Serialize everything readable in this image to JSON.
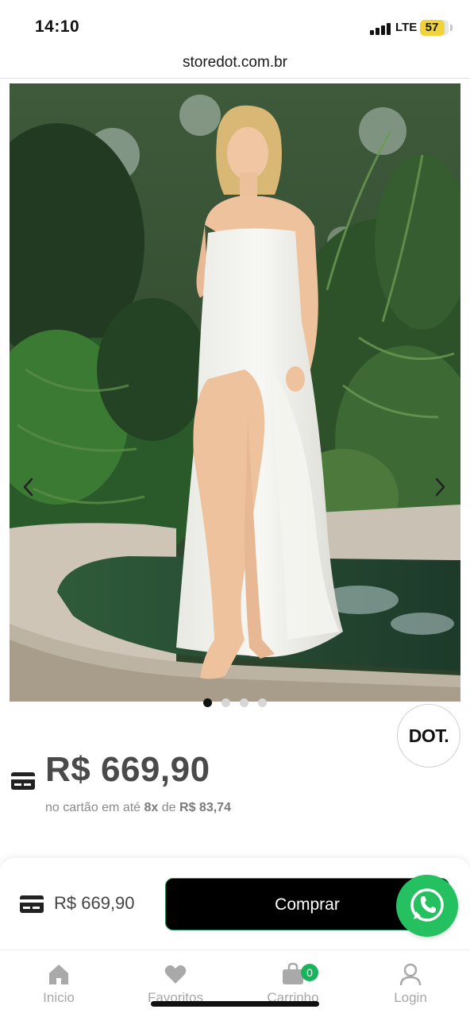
{
  "status_bar": {
    "time": "14:10",
    "network": "LTE",
    "battery_level": "57",
    "battery_color": "#f0d33a",
    "signal_icon": "signal-bars-icon"
  },
  "browser": {
    "url": "storedot.com.br"
  },
  "product": {
    "image_icon": "product-photo",
    "carousel_page_count": 4,
    "carousel_active_index": 0,
    "brand_badge": "DOT.",
    "price": "R$ 669,90",
    "installment_prefix": "no cartão em até",
    "installment_count": "8x",
    "installment_middle": "de",
    "installment_value": "R$ 83,74"
  },
  "buy_bar": {
    "price": "R$ 669,90",
    "buy_label": "Comprar",
    "whatsapp_icon": "whatsapp-icon",
    "accent_color": "#25c05f"
  },
  "nav": {
    "items": [
      {
        "label": "Inicio",
        "icon": "home-icon"
      },
      {
        "label": "Favoritos",
        "icon": "heart-icon"
      },
      {
        "label": "Carrinho",
        "icon": "shopping-bag-icon",
        "badge": "0"
      },
      {
        "label": "Login",
        "icon": "user-icon"
      }
    ]
  }
}
